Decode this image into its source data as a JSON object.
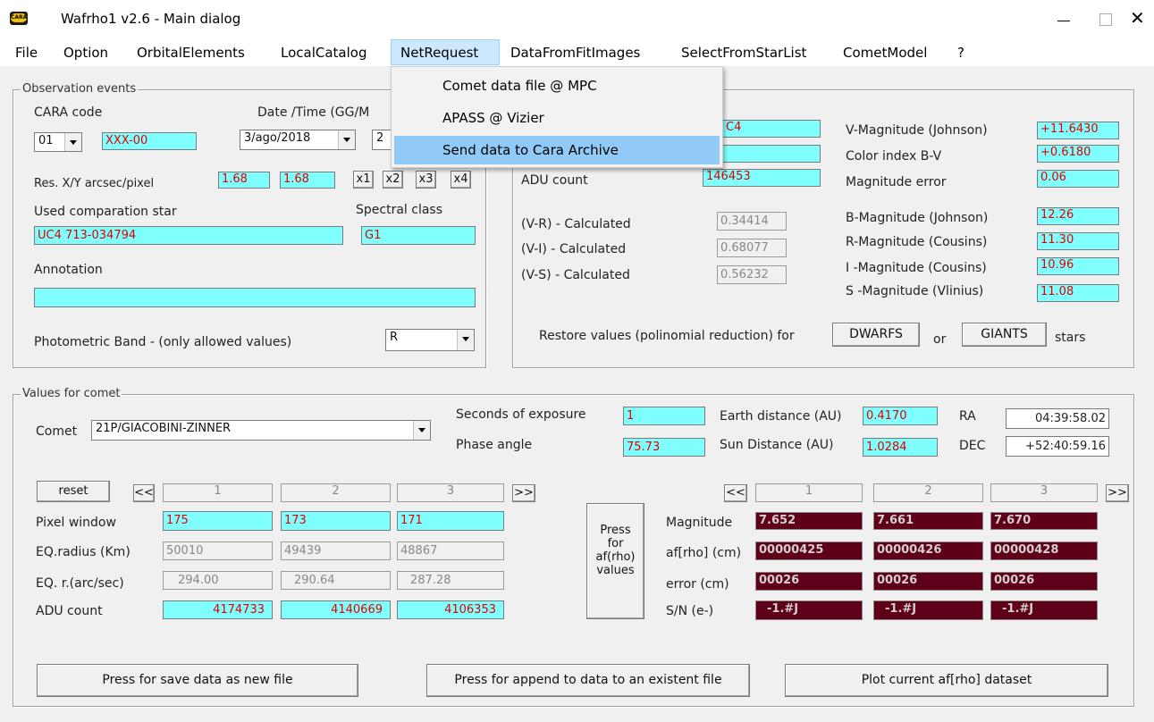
{
  "window": {
    "title": "Wafrho1 v2.6 - Main dialog",
    "app_icon_text": "CARA"
  },
  "menu": [
    "File",
    "Option",
    "OrbitalElements",
    "LocalCatalog",
    "NetRequest",
    "DataFromFitImages",
    "SelectFromStarList",
    "CometModel",
    "?"
  ],
  "netrequest_menu": [
    "Comet data file @ MPC",
    "APASS @ Vizier",
    "Send data to Cara Archive"
  ],
  "obs": {
    "title": "Observation events",
    "cara_label": "CARA code",
    "cara_num": "01",
    "cara_code": "XXX-00",
    "date_label": "Date /Time  (GG/M",
    "date_value": "3/ago/2018",
    "time_value": "2",
    "res_label": "Res.  X/Y arcsec/pixel",
    "res_x": "1.68",
    "res_y": "1.68",
    "zoom": [
      "x1",
      "x2",
      "x3",
      "x4"
    ],
    "comp_label": "Used comparation star",
    "comp_value": "UC4 713-034794",
    "spectral_label": "Spectral class",
    "spectral_value": "G1",
    "annotation_label": "Annotation",
    "annotation_value": "",
    "band_label": "Photometric Band  - (only allowed values)",
    "band_value": "R"
  },
  "star": {
    "cat_value": "C4",
    "adu_label": "ADU count",
    "adu_value": "146453",
    "vr_label": "(V-R) - Calculated",
    "vr_value": "0.34414",
    "vi_label": "(V-I) -  Calculated",
    "vi_value": "0.68077",
    "vs_label": "(V-S) - Calculated",
    "vs_value": "0.56232",
    "vmag_label": "V-Magnitude (Johnson)",
    "vmag_value": "+11.6430",
    "bv_label": "Color index B-V",
    "bv_value": "+0.6180",
    "magerr_label": "Magnitude error",
    "magerr_value": "0.06",
    "bmag_label": "B-Magnitude (Johnson)",
    "bmag_value": "12.26",
    "rmag_label": "R-Magnitude (Cousins)",
    "rmag_value": "11.30",
    "imag_label": "I -Magnitude (Cousins)",
    "imag_value": "10.96",
    "smag_label": "S -Magnitude (Vlinius)",
    "smag_value": "11.08",
    "restore_label": "Restore values (polinomial reduction) for",
    "dwarfs": "DWARFS",
    "or": "or",
    "giants": "GIANTS",
    "stars": "stars"
  },
  "comet": {
    "title": "Values for comet",
    "comet_label": "Comet",
    "comet_value": "21P/GIACOBINI-ZINNER",
    "exposure_label": "Seconds of exposure",
    "exposure_value": "1",
    "phase_label": "Phase angle",
    "phase_value": "75.73",
    "earth_label": "Earth distance (AU)",
    "earth_value": "0.4170",
    "sun_label": "Sun Distance (AU)",
    "sun_value": "1.0284",
    "ra_label": "RA",
    "ra_value": "04:39:58.02",
    "dec_label": "DEC",
    "dec_value": "+52:40:59.16",
    "reset": "reset",
    "prev": "<<",
    "next": ">>",
    "cols": [
      "1",
      "2",
      "3"
    ],
    "pixel_label": "Pixel window",
    "pixel": [
      "175",
      "173",
      "171"
    ],
    "eqrad_label": "EQ.radius (Km)",
    "eqrad": [
      "50010",
      "49439",
      "48867"
    ],
    "eqr_label": "EQ. r.(arc/sec)",
    "eqr": [
      "294.00",
      "290.64",
      "287.28"
    ],
    "adu_label": "ADU count",
    "adu": [
      "4174733",
      "4140669",
      "4106353"
    ],
    "press_btn": [
      "Press",
      "for",
      "af(rho)",
      "values"
    ],
    "mag_label": "Magnitude",
    "mag": [
      "7.652",
      "7.661",
      "7.670"
    ],
    "afrho_label": "af[rho] (cm)",
    "afrho": [
      "00000425",
      "00000426",
      "00000428"
    ],
    "err_label": "error (cm)",
    "err": [
      "00026",
      "00026",
      "00026"
    ],
    "sn_label": "S/N (e-)",
    "sn": [
      "-1.#J",
      "-1.#J",
      "-1.#J"
    ]
  },
  "bottom": {
    "save": "Press for save data as new file",
    "append": "Press for append to  data to an existent file",
    "plot": "Plot current af[rho] dataset"
  }
}
